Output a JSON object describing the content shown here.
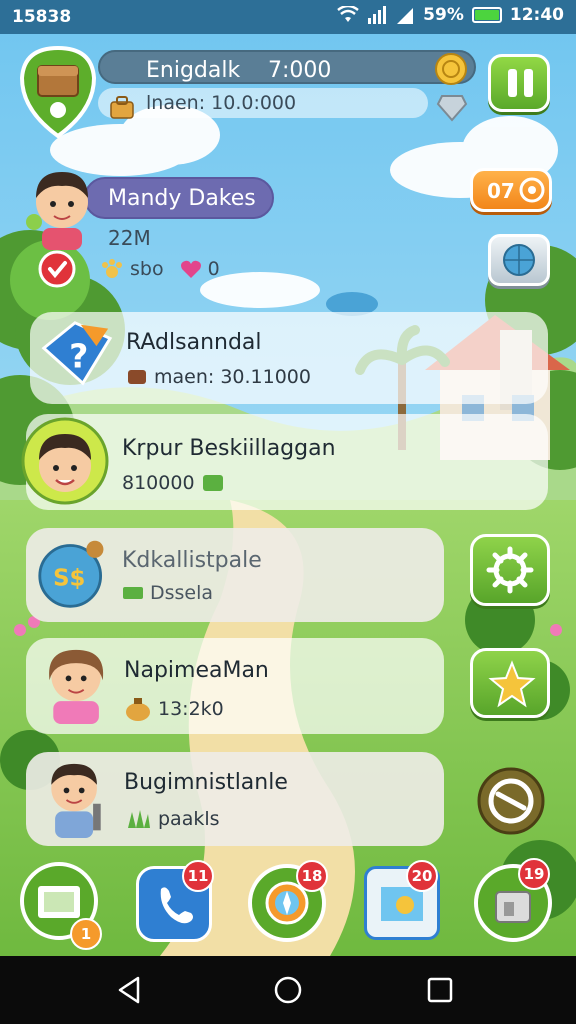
{
  "status_bar": {
    "time_left": "15838",
    "battery": "59%",
    "clock": "12:40",
    "battery_color": "#4cd43e"
  },
  "player": {
    "name": "Enigdalk",
    "gold": "7:000",
    "sub_label": "lnaen: 10.0:000"
  },
  "profile": {
    "name": "Mandy Dakes",
    "level": "22M",
    "stats": "sbo",
    "hearts": "0",
    "orange_button_label": "07"
  },
  "list": [
    {
      "title": "RAdlsanndal",
      "sub": "maen: 30.11000",
      "sub_icon": "chocolate-icon",
      "icon": "help-badge-icon"
    },
    {
      "title": "Krpur Beskiillaggan",
      "sub": "810000",
      "sub_icon": "leaf-icon",
      "icon": "boy-avatar-icon"
    },
    {
      "title": "Kdkallistpale",
      "sub": "Dssela",
      "sub_icon": "cash-icon",
      "icon": "globe-coin-icon"
    },
    {
      "title": "NapimeaMan",
      "sub": "13:2k0",
      "sub_icon": "bag-icon",
      "icon": "girl-avatar-icon"
    },
    {
      "title": "Bugimnistlanle",
      "sub": "paakls",
      "sub_icon": "grass-icon",
      "icon": "farmer-avatar-icon"
    }
  ],
  "dock": [
    {
      "name": "photo",
      "badge": "1",
      "icon": "photo-icon"
    },
    {
      "name": "phone",
      "badge": "11",
      "icon": "phone-icon"
    },
    {
      "name": "compass",
      "badge": "18",
      "icon": "compass-icon"
    },
    {
      "name": "map",
      "badge": "20",
      "icon": "map-icon"
    },
    {
      "name": "shop",
      "badge": "19",
      "icon": "shop-icon"
    }
  ],
  "colors": {
    "accent_green": "#6cbf34",
    "accent_orange": "#f59a2b",
    "badge_red": "#e0333a",
    "name_pill": "#6d6bb0"
  }
}
